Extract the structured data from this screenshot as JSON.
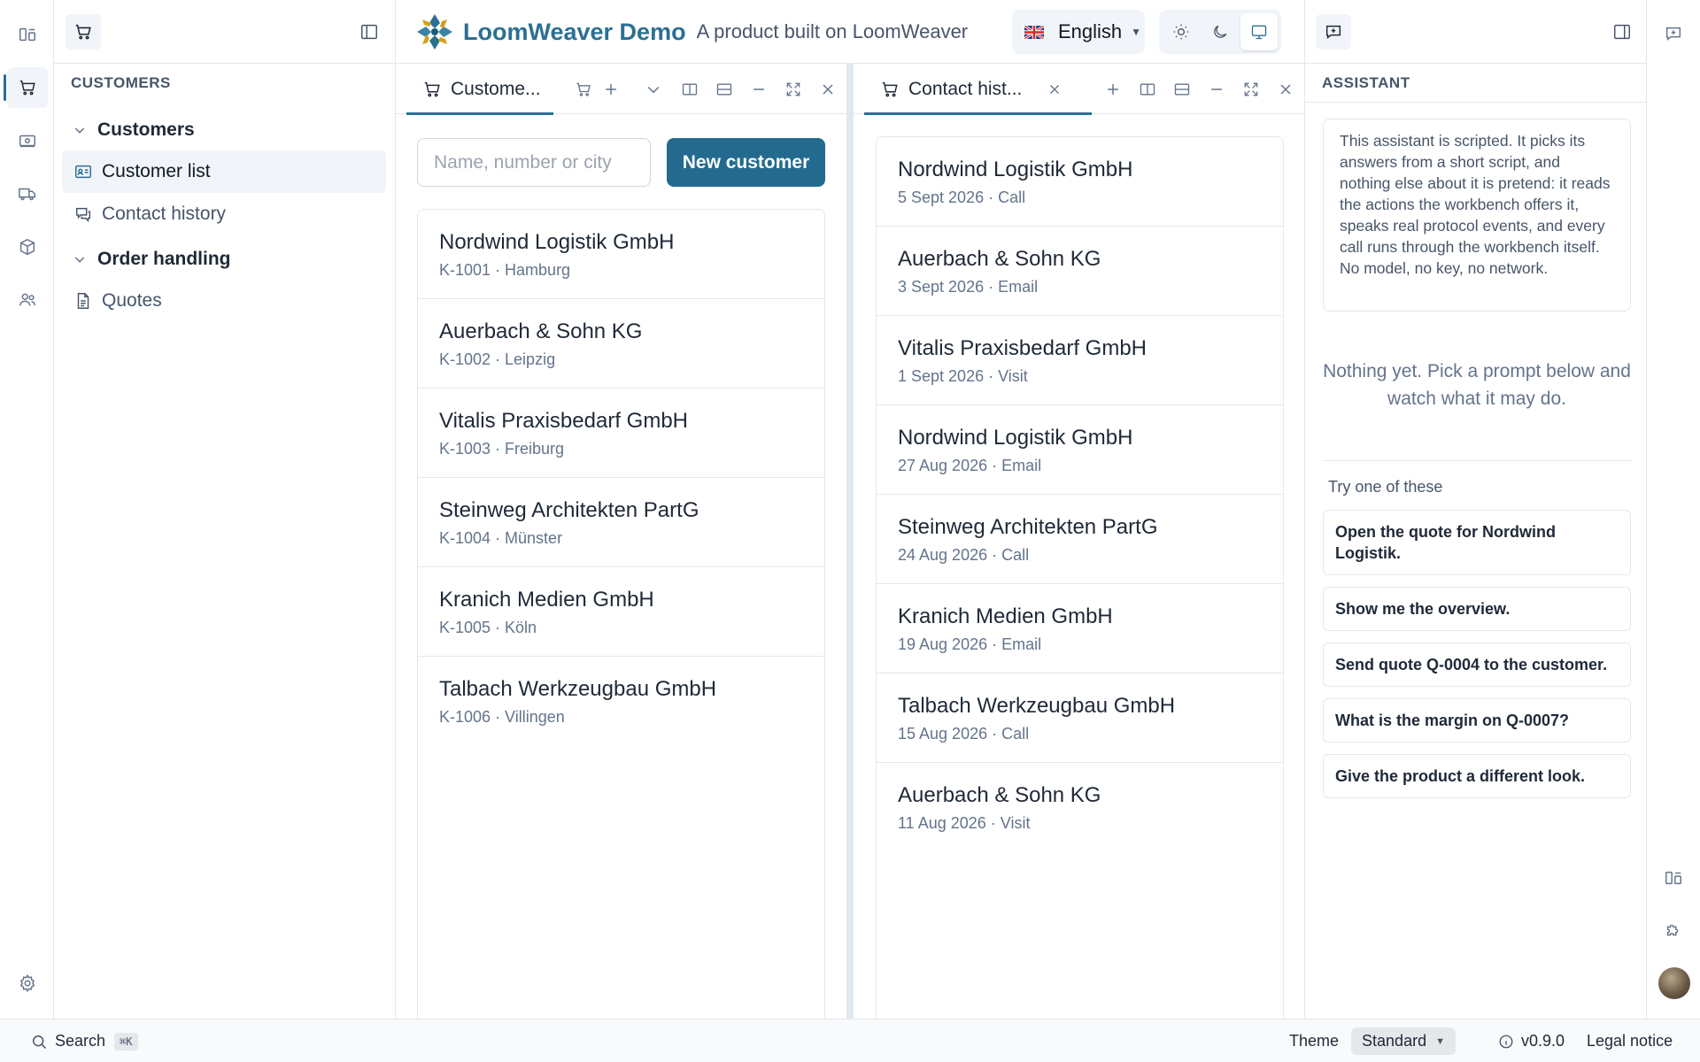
{
  "app": {
    "name": "LoomWeaver Demo",
    "tagline": "A product built on LoomWeaver",
    "accent": "#2b6f93",
    "primary_button": "#236a8e"
  },
  "header": {
    "language": "English",
    "language_flag": "uk-flag-icon",
    "theme_modes": [
      "sun-icon",
      "moon-icon",
      "monitor-icon"
    ],
    "theme_mode_selected": "monitor-icon"
  },
  "activity_bar": {
    "items": [
      "dashboard-icon",
      "cart-icon",
      "money-icon",
      "truck-icon",
      "box-icon",
      "users-icon"
    ],
    "active": "cart-icon",
    "bottom": "settings-icon"
  },
  "sidebar": {
    "title": "CUSTOMERS",
    "groups": [
      {
        "label": "Customers",
        "items": [
          {
            "label": "Customer list",
            "icon": "id-card-icon"
          },
          {
            "label": "Contact history",
            "icon": "chat-icon"
          }
        ]
      },
      {
        "label": "Order handling",
        "items": [
          {
            "label": "Quotes",
            "icon": "document-icon"
          }
        ]
      }
    ],
    "selected": "Customer list"
  },
  "left_pane": {
    "tab_label": "Custome...",
    "search_placeholder": "Name, number or city",
    "new_button": "New customer",
    "customers": [
      {
        "name": "Nordwind Logistik GmbH",
        "meta": "K-1001 · Hamburg"
      },
      {
        "name": "Auerbach & Sohn KG",
        "meta": "K-1002 · Leipzig"
      },
      {
        "name": "Vitalis Praxisbedarf GmbH",
        "meta": "K-1003 · Freiburg"
      },
      {
        "name": "Steinweg Architekten PartG",
        "meta": "K-1004 · Münster"
      },
      {
        "name": "Kranich Medien GmbH",
        "meta": "K-1005 · Köln"
      },
      {
        "name": "Talbach Werkzeugbau GmbH",
        "meta": "K-1006 · Villingen"
      }
    ]
  },
  "right_pane": {
    "tab_label": "Contact hist...",
    "contacts": [
      {
        "name": "Nordwind Logistik GmbH",
        "meta": "5 Sept 2026 · Call"
      },
      {
        "name": "Auerbach & Sohn KG",
        "meta": "3 Sept 2026 · Email"
      },
      {
        "name": "Vitalis Praxisbedarf GmbH",
        "meta": "1 Sept 2026 · Visit"
      },
      {
        "name": "Nordwind Logistik GmbH",
        "meta": "27 Aug 2026 · Email"
      },
      {
        "name": "Steinweg Architekten PartG",
        "meta": "24 Aug 2026 · Call"
      },
      {
        "name": "Kranich Medien GmbH",
        "meta": "19 Aug 2026 · Email"
      },
      {
        "name": "Talbach Werkzeugbau GmbH",
        "meta": "15 Aug 2026 · Call"
      },
      {
        "name": "Auerbach & Sohn KG",
        "meta": "11 Aug 2026 · Visit"
      }
    ]
  },
  "assistant": {
    "title": "ASSISTANT",
    "info": "This assistant is scripted. It picks its answers from a short script, and nothing else about it is pretend: it reads the actions the workbench offers it, speaks real protocol events, and every call runs through the workbench itself. No model, no key, no network.",
    "empty": "Nothing yet. Pick a prompt below and watch what it may do.",
    "try_label": "Try one of these",
    "prompts": [
      "Open the quote for Nordwind Logistik.",
      "Show me the overview.",
      "Send quote Q-0004 to the customer.",
      "What is the margin on Q-0007?",
      "Give the product a different look."
    ]
  },
  "status": {
    "search": "Search",
    "shortcut": "⌘K",
    "theme_label": "Theme",
    "theme_value": "Standard",
    "version": "v0.9.0",
    "legal": "Legal notice"
  }
}
